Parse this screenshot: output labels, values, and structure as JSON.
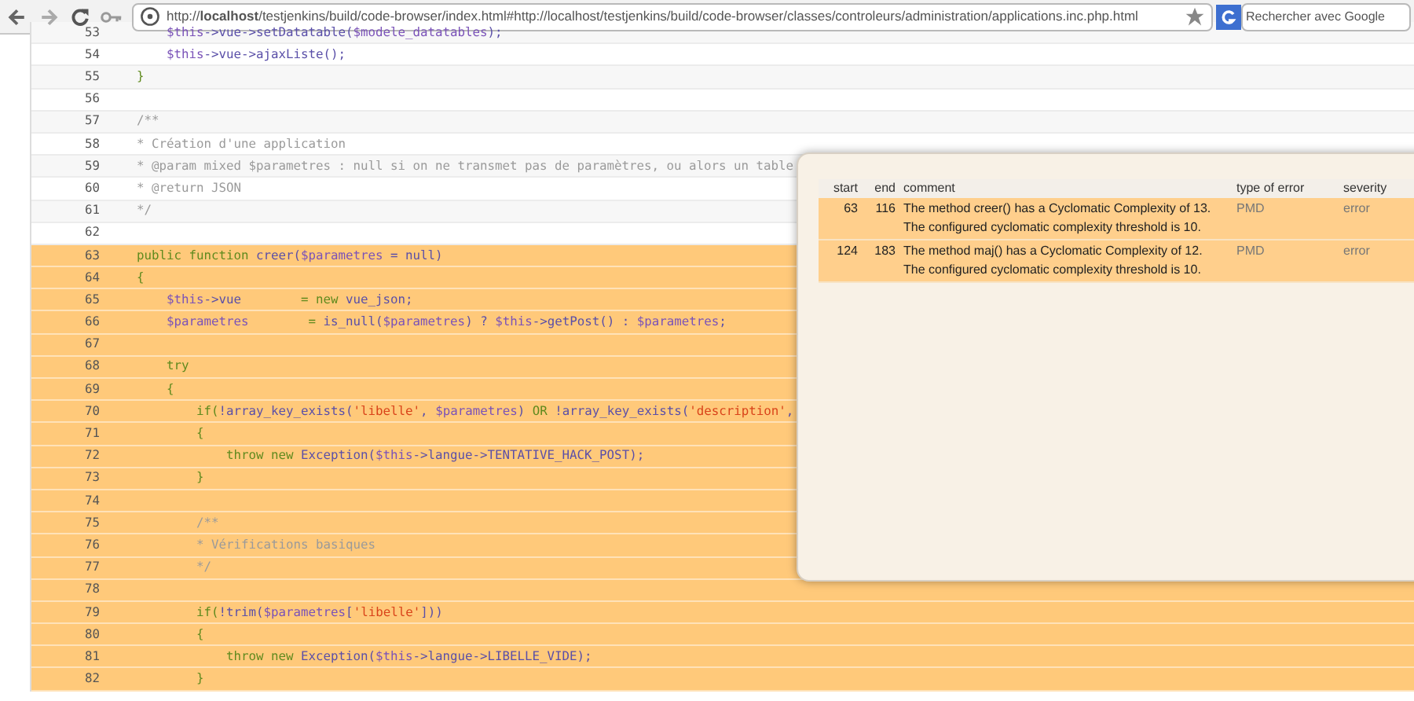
{
  "browser": {
    "url": "http://**localhost**/testjenkins/build/code-browser/index.html#http://localhost/testjenkins/build/code-browser/classes/controleurs/administration/applications.inc.php.html",
    "search_placeholder": "Rechercher avec Google"
  },
  "code_lines": [
    {
      "number": "53",
      "highlighted": false,
      "tokens": [
        {
          "kind": "var",
          "text": "        $this"
        },
        {
          "kind": "plain",
          "text": "->vue->setDatatable("
        },
        {
          "kind": "var",
          "text": "$modele_datatables"
        },
        {
          "kind": "plain",
          "text": ");"
        }
      ]
    },
    {
      "number": "54",
      "highlighted": false,
      "tokens": [
        {
          "kind": "var",
          "text": "        $this"
        },
        {
          "kind": "plain",
          "text": "->vue->ajaxListe();"
        }
      ]
    },
    {
      "number": "55",
      "highlighted": false,
      "tokens": [
        {
          "kind": "keyword",
          "text": "    }"
        }
      ]
    },
    {
      "number": "56",
      "highlighted": false
    },
    {
      "number": "57",
      "highlighted": false,
      "tokens": [
        {
          "kind": "comment",
          "text": "    /**"
        }
      ]
    },
    {
      "number": "58",
      "highlighted": false,
      "tokens": [
        {
          "kind": "comment",
          "text": "    * Création d'une application"
        }
      ]
    },
    {
      "number": "59",
      "highlighted": false,
      "tokens": [
        {
          "kind": "comment",
          "text": "    * @param mixed $parametres : null si on ne transmet pas de paramètres, ou alors un table"
        }
      ]
    },
    {
      "number": "60",
      "highlighted": false,
      "tokens": [
        {
          "kind": "comment",
          "text": "    * @return JSON"
        }
      ]
    },
    {
      "number": "61",
      "highlighted": false,
      "tokens": [
        {
          "kind": "comment",
          "text": "    */"
        }
      ]
    },
    {
      "number": "62",
      "highlighted": false
    },
    {
      "number": "63",
      "highlighted": true,
      "tokens": [
        {
          "kind": "keyword",
          "text": "    public function "
        },
        {
          "kind": "plain",
          "text": "creer("
        },
        {
          "kind": "var",
          "text": "$parametres"
        },
        {
          "kind": "plain",
          "text": " = null)"
        }
      ]
    },
    {
      "number": "64",
      "highlighted": true,
      "tokens": [
        {
          "kind": "keyword",
          "text": "    {"
        }
      ]
    },
    {
      "number": "65",
      "highlighted": true,
      "tokens": [
        {
          "kind": "var",
          "text": "        $this"
        },
        {
          "kind": "plain",
          "text": "->vue        "
        },
        {
          "kind": "keyword",
          "text": "= new "
        },
        {
          "kind": "plain",
          "text": "vue_json;"
        }
      ]
    },
    {
      "number": "66",
      "highlighted": true,
      "tokens": [
        {
          "kind": "var",
          "text": "        $parametres"
        },
        {
          "kind": "keyword",
          "text": "        = "
        },
        {
          "kind": "plain",
          "text": "is_null("
        },
        {
          "kind": "var",
          "text": "$parametres"
        },
        {
          "kind": "plain",
          "text": ") ? "
        },
        {
          "kind": "var",
          "text": "$this"
        },
        {
          "kind": "plain",
          "text": "->getPost() : "
        },
        {
          "kind": "var",
          "text": "$parametres"
        },
        {
          "kind": "plain",
          "text": ";"
        }
      ]
    },
    {
      "number": "67",
      "highlighted": true
    },
    {
      "number": "68",
      "highlighted": true,
      "tokens": [
        {
          "kind": "keyword",
          "text": "        try"
        }
      ]
    },
    {
      "number": "69",
      "highlighted": true,
      "tokens": [
        {
          "kind": "keyword",
          "text": "        {"
        }
      ]
    },
    {
      "number": "70",
      "highlighted": true,
      "tokens": [
        {
          "kind": "keyword",
          "text": "            if("
        },
        {
          "kind": "plain",
          "text": "!array_key_exists("
        },
        {
          "kind": "string",
          "text": "'libelle'"
        },
        {
          "kind": "plain",
          "text": ", "
        },
        {
          "kind": "var",
          "text": "$parametres"
        },
        {
          "kind": "plain",
          "text": ") "
        },
        {
          "kind": "keyword",
          "text": "OR "
        },
        {
          "kind": "plain",
          "text": "!array_key_exists("
        },
        {
          "kind": "string",
          "text": "'description'"
        },
        {
          "kind": "plain",
          "text": ","
        }
      ]
    },
    {
      "number": "71",
      "highlighted": true,
      "tokens": [
        {
          "kind": "keyword",
          "text": "            {"
        }
      ]
    },
    {
      "number": "72",
      "highlighted": true,
      "tokens": [
        {
          "kind": "keyword",
          "text": "                throw new "
        },
        {
          "kind": "plain",
          "text": "Exception("
        },
        {
          "kind": "var",
          "text": "$this"
        },
        {
          "kind": "plain",
          "text": "->langue->TENTATIVE_HACK_POST);"
        }
      ]
    },
    {
      "number": "73",
      "highlighted": true,
      "tokens": [
        {
          "kind": "keyword",
          "text": "            }"
        }
      ]
    },
    {
      "number": "74",
      "highlighted": true
    },
    {
      "number": "75",
      "highlighted": true,
      "tokens": [
        {
          "kind": "comment",
          "text": "            /**"
        }
      ]
    },
    {
      "number": "76",
      "highlighted": true,
      "tokens": [
        {
          "kind": "comment",
          "text": "            * Vérifications basiques"
        }
      ]
    },
    {
      "number": "77",
      "highlighted": true,
      "tokens": [
        {
          "kind": "comment",
          "text": "            */"
        }
      ]
    },
    {
      "number": "78",
      "highlighted": true
    },
    {
      "number": "79",
      "highlighted": true,
      "tokens": [
        {
          "kind": "keyword",
          "text": "            if("
        },
        {
          "kind": "plain",
          "text": "!trim("
        },
        {
          "kind": "var",
          "text": "$parametres"
        },
        {
          "kind": "plain",
          "text": "["
        },
        {
          "kind": "string",
          "text": "'libelle'"
        },
        {
          "kind": "plain",
          "text": "]))"
        }
      ]
    },
    {
      "number": "80",
      "highlighted": true,
      "tokens": [
        {
          "kind": "keyword",
          "text": "            {"
        }
      ]
    },
    {
      "number": "81",
      "highlighted": true,
      "tokens": [
        {
          "kind": "keyword",
          "text": "                throw new "
        },
        {
          "kind": "plain",
          "text": "Exception("
        },
        {
          "kind": "var",
          "text": "$this"
        },
        {
          "kind": "plain",
          "text": "->langue->LIBELLE_VIDE);"
        }
      ]
    },
    {
      "number": "82",
      "highlighted": true,
      "tokens": [
        {
          "kind": "keyword",
          "text": "            }"
        }
      ]
    }
  ],
  "errors_popup": {
    "columns": [
      "start",
      "end",
      "comment",
      "type of error",
      "severity"
    ],
    "rows": [
      {
        "start": "63",
        "end": "116",
        "comment_lines": [
          "The method creer() has a Cyclomatic Complexity of 13.",
          "The configured cyclomatic complexity threshold is 10."
        ],
        "type_of_error": "PMD",
        "severity": "error"
      },
      {
        "start": "124",
        "end": "183",
        "comment_lines": [
          "The method maj() has a Cyclomatic Complexity of 12.",
          "The configured cyclomatic complexity threshold is 10."
        ],
        "type_of_error": "PMD",
        "severity": "error"
      }
    ]
  }
}
